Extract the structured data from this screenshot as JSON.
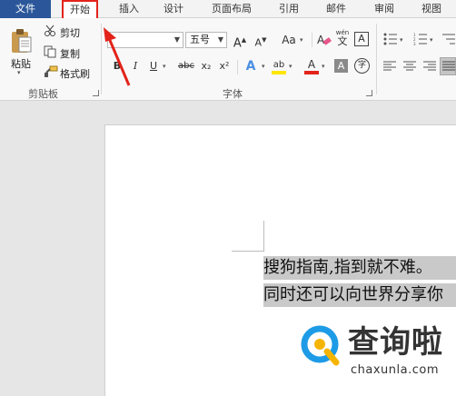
{
  "tabs": [
    {
      "label": "文件"
    },
    {
      "label": "开始"
    },
    {
      "label": "插入"
    },
    {
      "label": "设计"
    },
    {
      "label": "页面布局"
    },
    {
      "label": "引用"
    },
    {
      "label": "邮件"
    },
    {
      "label": "审阅"
    },
    {
      "label": "视图"
    }
  ],
  "clipboard": {
    "paste": "粘贴",
    "cut": "剪切",
    "copy": "复制",
    "format_painter": "格式刷",
    "group_label": "剪贴板"
  },
  "font": {
    "font_name": "",
    "font_size": "五号",
    "grow": "A",
    "shrink": "A",
    "case": "Aa",
    "phonetic_top": "wén",
    "phonetic_bottom": "文",
    "border_char": "A",
    "bold": "B",
    "italic": "I",
    "underline": "U",
    "strike": "abc",
    "sub": "x₂",
    "sup": "x²",
    "effects": "A",
    "highlight": "ab",
    "font_color": "A",
    "shading": "A",
    "enclose": "字",
    "group_label": "字体"
  },
  "document": {
    "lines": [
      "搜狗指南,指到就不难。",
      "同时还可以向世界分享你"
    ]
  },
  "watermark": {
    "title": "查询啦",
    "url": "chaxunla.com"
  },
  "colors": {
    "file_tab": "#2b579a",
    "highlight_outline": "#e2231a",
    "selection": "#c9c9c9",
    "logo_blue": "#1e9be6",
    "logo_yellow": "#f5b400"
  }
}
